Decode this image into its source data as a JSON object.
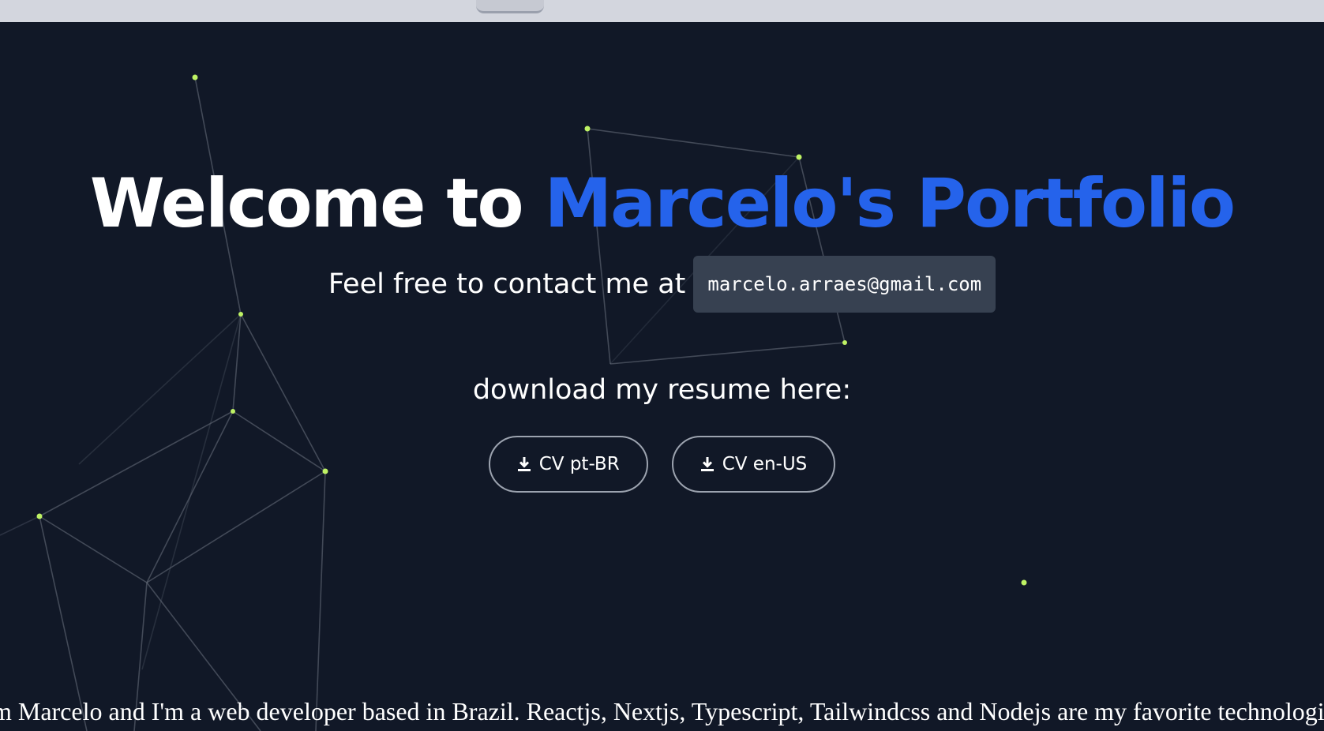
{
  "hero": {
    "title_plain": "Welcome to ",
    "title_accent": "Marcelo's Portfolio",
    "contact_text": "Feel free to contact me at",
    "email": "marcelo.arraes@gmail.com",
    "resume_label": "download my resume here:",
    "buttons": [
      {
        "label": "CV pt-BR",
        "icon": "download-icon"
      },
      {
        "label": "CV en-US",
        "icon": "download-icon"
      }
    ]
  },
  "marquee": {
    "text": "m Marcelo and I'm a web developer based in Brazil. Reactjs, Nextjs, Typescript, Tailwindcss and Nodejs are my favorite technologies"
  },
  "colors": {
    "background": "#111827",
    "accent": "#2563eb",
    "node": "#bef264",
    "line": "#6b7280",
    "email_box": "#374151"
  }
}
